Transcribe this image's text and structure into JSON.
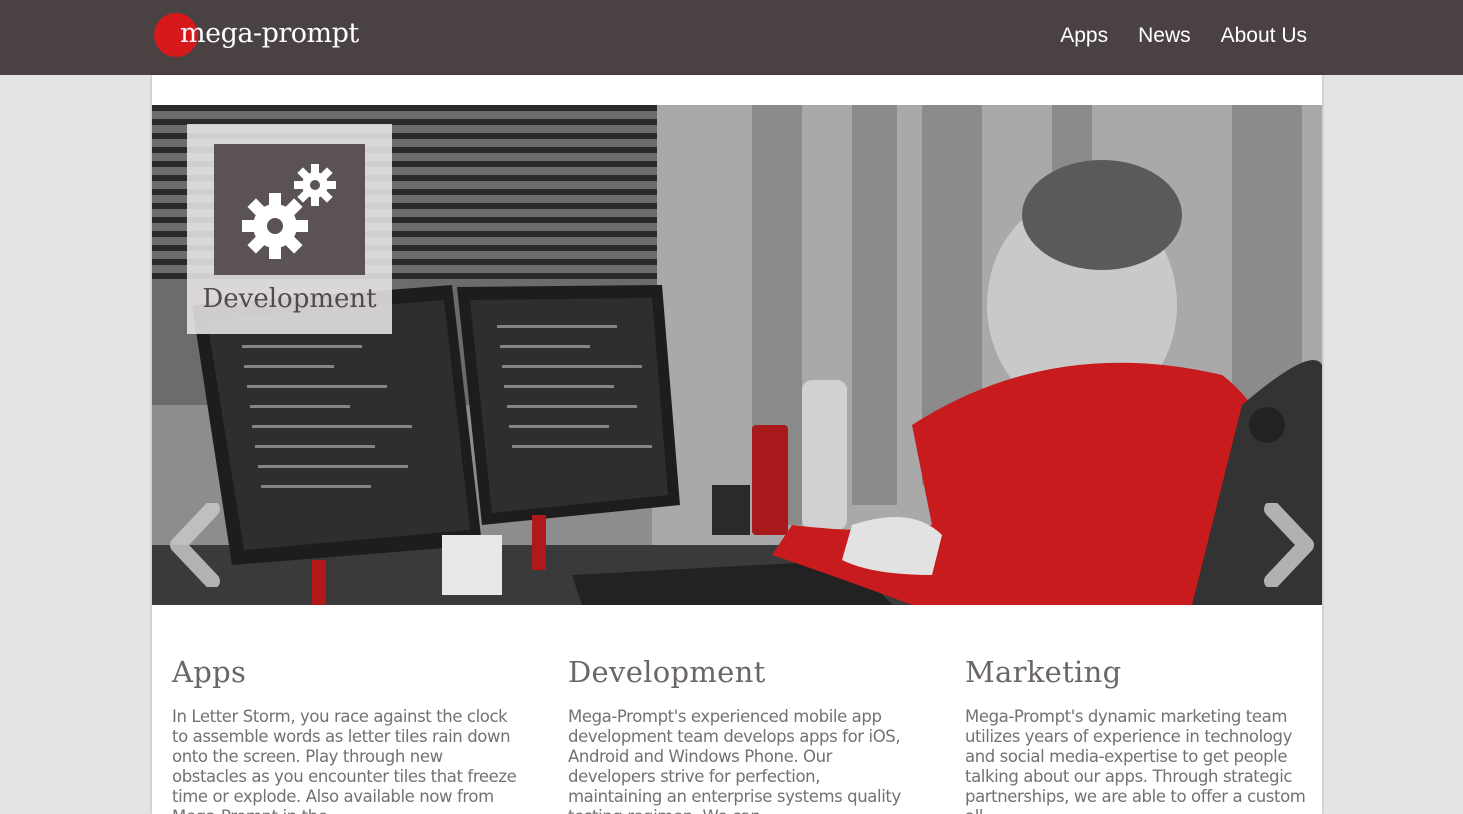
{
  "header": {
    "logo_text": "mega-prompt",
    "nav": [
      {
        "label": "Apps"
      },
      {
        "label": "News"
      },
      {
        "label": "About Us"
      }
    ]
  },
  "hero": {
    "badge_label": "Development",
    "badge_icon": "gears-icon",
    "prev_icon": "chevron-left-icon",
    "next_icon": "chevron-right-icon"
  },
  "columns": [
    {
      "title": "Apps",
      "text": "In Letter Storm, you race against the clock to assemble words as letter tiles rain down onto the screen. Play through new obstacles as you encounter tiles that freeze time or explode. Also available now from Mega-Prompt in the"
    },
    {
      "title": "Development",
      "text": "Mega-Prompt's experienced mobile app development team develops apps for iOS, Android and Windows Phone. Our developers strive for perfection, maintaining an enterprise systems quality testing regimen. We can"
    },
    {
      "title": "Marketing",
      "text": "Mega-Prompt's dynamic marketing team utilizes years of experience in technology and social media-expertise to get people talking about our apps. Through strategic partnerships, we are able to offer a custom all-"
    }
  ],
  "colors": {
    "header_bg": "#4a4143",
    "accent_red": "#d7191c",
    "page_bg": "#e4e4e4"
  }
}
